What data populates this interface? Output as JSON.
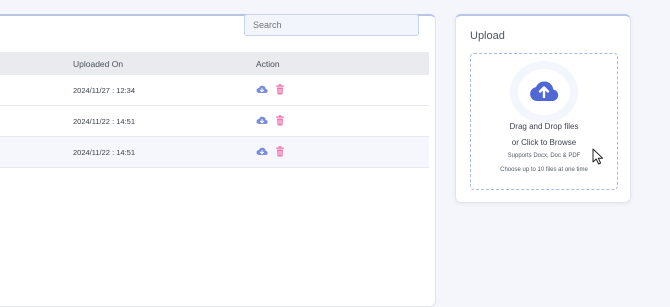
{
  "search": {
    "placeholder": "Search"
  },
  "table": {
    "headers": {
      "uploaded_on": "Uploaded On",
      "action": "Action"
    },
    "rows": [
      {
        "uploaded_on": "2024/11/27 : 12:34"
      },
      {
        "uploaded_on": "2024/11/22 : 14:51"
      },
      {
        "uploaded_on": "2024/11/22 : 14:51"
      }
    ],
    "action_icons": [
      "download-cloud-icon",
      "trash-icon"
    ]
  },
  "upload": {
    "title": "Upload",
    "line1": "Drag and Drop files",
    "line2": "or Click to Browse",
    "supports": "Supports Docx, Doc & PDF",
    "limit": "Choose up to 10 files at one time"
  },
  "colors": {
    "accent": "#4f68d6",
    "delete": "#f07ab0",
    "download": "#7a8fdc"
  }
}
